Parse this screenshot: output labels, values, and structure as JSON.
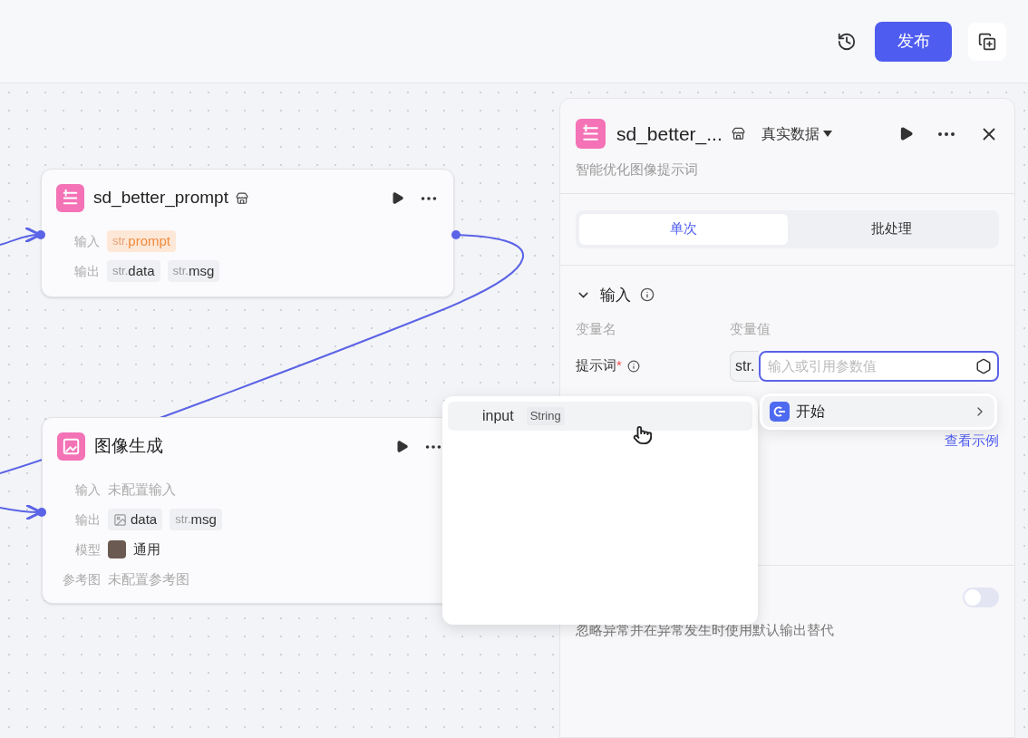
{
  "toolbar": {
    "publish_button": "发布"
  },
  "nodes": [
    {
      "kind": "code",
      "title": "sd_better_prompt",
      "store_mark": true,
      "rows": [
        {
          "label": "输入",
          "kind": "tags",
          "tags": [
            {
              "kind": "str",
              "prefix": "str.",
              "name": "prompt",
              "highlighted": true
            }
          ]
        },
        {
          "label": "输出",
          "kind": "tags",
          "tags": [
            {
              "kind": "str",
              "prefix": "str.",
              "name": "data",
              "highlighted": false
            },
            {
              "kind": "str",
              "prefix": "str.",
              "name": "msg",
              "highlighted": false
            }
          ]
        }
      ]
    },
    {
      "kind": "image",
      "title": "图像生成",
      "store_mark": false,
      "rows": [
        {
          "label": "输入",
          "kind": "text",
          "text": "未配置输入"
        },
        {
          "label": "输出",
          "kind": "tags",
          "tags": [
            {
              "kind": "image",
              "name": "data",
              "highlighted": false
            },
            {
              "kind": "str",
              "prefix": "str.",
              "name": "msg",
              "highlighted": false
            }
          ]
        },
        {
          "label": "模型",
          "kind": "model",
          "text": "通用"
        },
        {
          "label": "参考图",
          "kind": "text",
          "text": "未配置参考图"
        }
      ]
    }
  ],
  "panel": {
    "title": "sd_better_...",
    "data_source": "真实数据",
    "description": "智能优化图像提示词",
    "tabs": [
      {
        "label": "单次",
        "selected": true
      },
      {
        "label": "批处理",
        "selected": false
      }
    ],
    "section": {
      "title": "输入",
      "expanded": true
    },
    "columns": [
      "变量名",
      "变量值"
    ],
    "params": [
      {
        "name": "提示词",
        "required_mark": "*",
        "type": "str.",
        "placeholder": "输入或引用参数值"
      }
    ],
    "example_link": "查看示例",
    "toggle": {
      "on": false
    },
    "toggle_description": "忽略异常并在异常发生时使用默认输出替代"
  },
  "reference_menu": {
    "items": [
      {
        "label": "开始",
        "selected": true
      }
    ]
  },
  "variable_menu": {
    "items": [
      {
        "name": "input",
        "type": "String",
        "selected": true
      }
    ]
  }
}
